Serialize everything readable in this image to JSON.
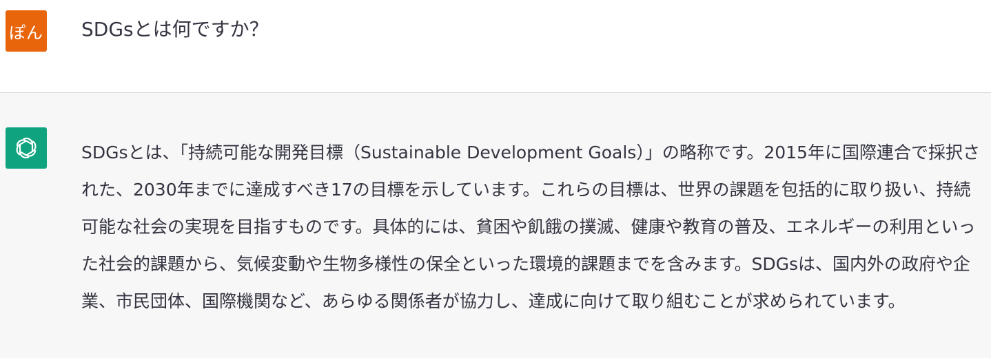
{
  "user": {
    "avatar_label": "ぽん",
    "avatar_color": "#e8650c",
    "message": "SDGsとは何ですか？"
  },
  "assistant": {
    "avatar_icon": "openai-logo-icon",
    "avatar_color": "#10a37f",
    "message": "SDGsとは、「持続可能な開発目標（Sustainable Development Goals）」の略称です。2015年に国際連合で採択された、2030年までに達成すべき17の目標を示しています。これらの目標は、世界の課題を包括的に取り扱い、持続可能な社会の実現を目指すものです。具体的には、貧困や飢餓の撲滅、健康や教育の普及、エネルギーの利用といった社会的課題から、気候変動や生物多様性の保全といった環境的課題までを含みます。SDGsは、国内外の政府や企業、市民団体、国際機関など、あらゆる関係者が協力し、達成に向けて取り組むことが求められています。"
  }
}
